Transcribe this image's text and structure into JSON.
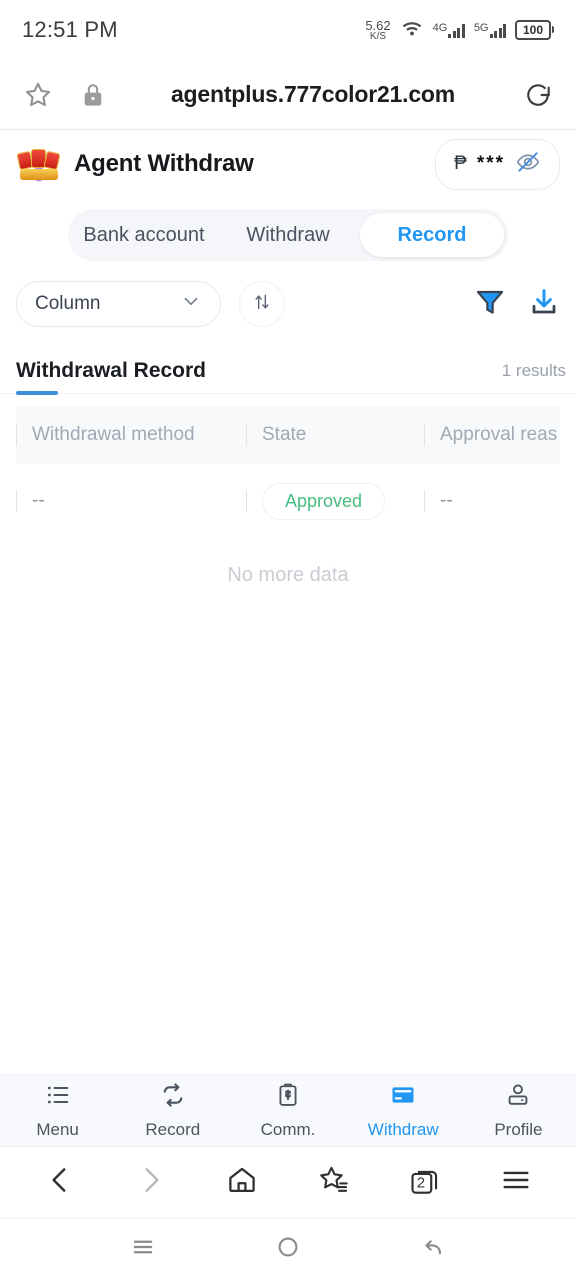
{
  "status_bar": {
    "time": "12:51 PM",
    "net_speed_value": "5.62",
    "net_speed_unit": "K/S",
    "wifi_icon": "wifi-icon",
    "network_1": "4G",
    "network_2": "5G",
    "battery_level": "100"
  },
  "browser_top": {
    "bookmark_icon": "star-icon",
    "lock_icon": "lock-icon",
    "url": "agentplus.777color21.com",
    "reload_icon": "reload-icon"
  },
  "app_header": {
    "logo_icon": "brand-logo-icon",
    "title": "Agent Withdraw",
    "currency_symbol": "₱",
    "balance_masked": "***",
    "visibility_icon": "eye-off-icon"
  },
  "segmented_tabs": [
    {
      "label": "Bank account",
      "active": false
    },
    {
      "label": "Withdraw",
      "active": false
    },
    {
      "label": "Record",
      "active": true
    }
  ],
  "toolbar": {
    "column_select_label": "Column",
    "chevron_icon": "chevron-down-icon",
    "sort_icon": "sort-updown-icon",
    "filter_icon": "filter-icon",
    "download_icon": "download-icon"
  },
  "record_section": {
    "title": "Withdrawal Record",
    "results_count": "1 results"
  },
  "table": {
    "columns": [
      "Withdrawal method",
      "State",
      "Approval reas"
    ],
    "rows": [
      {
        "withdrawal_method": "--",
        "state": "Approved",
        "approval_reason": "--"
      }
    ],
    "footer_text": "No more data"
  },
  "app_nav": [
    {
      "label": "Menu",
      "icon": "list-icon",
      "active": false
    },
    {
      "label": "Record",
      "icon": "loop-arrows-icon",
      "active": false
    },
    {
      "label": "Comm.",
      "icon": "clipboard-dollar-icon",
      "active": false
    },
    {
      "label": "Withdraw",
      "icon": "credit-card-icon",
      "active": true
    },
    {
      "label": "Profile",
      "icon": "person-icon",
      "active": false
    }
  ],
  "browser_bottom": {
    "back_icon": "chevron-left-icon",
    "forward_icon": "chevron-right-icon",
    "home_icon": "home-icon",
    "bookmarks_icon": "star-list-icon",
    "tabs_icon": "tabs-icon",
    "tabs_count": "2",
    "menu_icon": "hamburger-menu-icon"
  },
  "android_nav": {
    "recents_icon": "recents-icon",
    "home_icon": "home-circle-icon",
    "back_icon": "back-arrow-icon"
  },
  "colors": {
    "accent": "#2196f3",
    "approved_green": "#45bd7e",
    "muted_text": "#9aa1ab"
  }
}
